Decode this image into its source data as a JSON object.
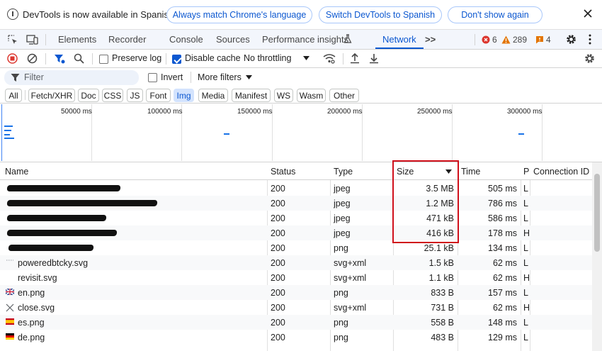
{
  "infobar": {
    "message": "DevTools is now available in Spanish!",
    "btn_match": "Always match Chrome's language",
    "btn_switch": "Switch DevTools to Spanish",
    "btn_dont_show": "Don't show again"
  },
  "tabs": {
    "elements": "Elements",
    "recorder": "Recorder",
    "console": "Console",
    "sources": "Sources",
    "performance": "Performance insights",
    "network": "Network",
    "more": ">>"
  },
  "badges": {
    "errors": "6",
    "warnings": "289",
    "issues": "4"
  },
  "toolbar": {
    "preserve_log": "Preserve log",
    "disable_cache": "Disable cache",
    "throttling": "No throttling"
  },
  "filter": {
    "placeholder": "Filter",
    "invert": "Invert",
    "more_filters": "More filters"
  },
  "chips": [
    "All",
    "Fetch/XHR",
    "Doc",
    "CSS",
    "JS",
    "Font",
    "Img",
    "Media",
    "Manifest",
    "WS",
    "Wasm",
    "Other"
  ],
  "overview": {
    "ticks": [
      "50000 ms",
      "100000 ms",
      "150000 ms",
      "200000 ms",
      "250000 ms",
      "300000 ms"
    ]
  },
  "table": {
    "headers": {
      "name": "Name",
      "status": "Status",
      "type": "Type",
      "size": "Size",
      "time": "Time",
      "priority": "P",
      "connection": "Connection ID"
    },
    "rows": [
      {
        "name": "",
        "status": "200",
        "type": "jpeg",
        "size": "3.5 MB",
        "time": "505 ms",
        "p": "L"
      },
      {
        "name": "",
        "status": "200",
        "type": "jpeg",
        "size": "1.2 MB",
        "time": "786 ms",
        "p": "L"
      },
      {
        "name": "",
        "status": "200",
        "type": "jpeg",
        "size": "471 kB",
        "time": "586 ms",
        "p": "L"
      },
      {
        "name": "",
        "status": "200",
        "type": "jpeg",
        "size": "416 kB",
        "time": "178 ms",
        "p": "H"
      },
      {
        "name": "",
        "status": "200",
        "type": "png",
        "size": "25.1 kB",
        "time": "134 ms",
        "p": "L"
      },
      {
        "name": "poweredbtcky.svg",
        "status": "200",
        "type": "svg+xml",
        "size": "1.5 kB",
        "time": "62 ms",
        "p": "L"
      },
      {
        "name": "revisit.svg",
        "status": "200",
        "type": "svg+xml",
        "size": "1.1 kB",
        "time": "62 ms",
        "p": "H"
      },
      {
        "name": "en.png",
        "status": "200",
        "type": "png",
        "size": "833 B",
        "time": "157 ms",
        "p": "L"
      },
      {
        "name": "close.svg",
        "status": "200",
        "type": "svg+xml",
        "size": "731 B",
        "time": "62 ms",
        "p": "H"
      },
      {
        "name": "es.png",
        "status": "200",
        "type": "png",
        "size": "558 B",
        "time": "148 ms",
        "p": "L"
      },
      {
        "name": "de.png",
        "status": "200",
        "type": "png",
        "size": "483 B",
        "time": "129 ms",
        "p": "L"
      }
    ]
  }
}
